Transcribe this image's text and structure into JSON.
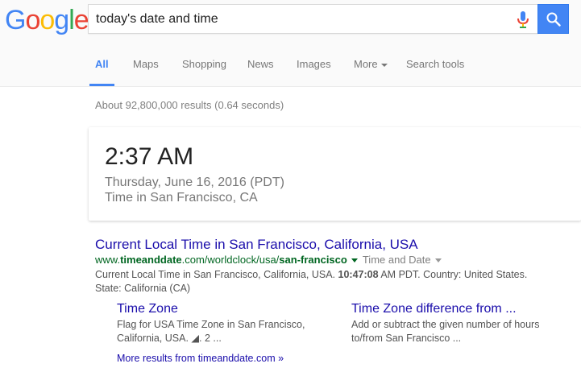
{
  "logo": {
    "letters": [
      "G",
      "o",
      "o",
      "g",
      "l",
      "e"
    ]
  },
  "search": {
    "query": "today's date and time"
  },
  "tabs": [
    {
      "label": "All"
    },
    {
      "label": "Maps"
    },
    {
      "label": "Shopping"
    },
    {
      "label": "News"
    },
    {
      "label": "Images"
    },
    {
      "label": "More"
    },
    {
      "label": "Search tools"
    }
  ],
  "stats": "About 92,800,000 results (0.64 seconds)",
  "time_card": {
    "time": "2:37 AM",
    "date": "Thursday, June 16, 2016 (PDT)",
    "location": "Time in San Francisco, CA"
  },
  "result": {
    "title": "Current Local Time in San Francisco, California, USA",
    "url_prefix": "www.",
    "url_domain": "timeanddate",
    "url_mid": ".com/worldclock/usa/",
    "url_path_bold": "san-francisco",
    "breadcrumb": "Time and Date",
    "snippet_start": "Current Local Time in San Francisco, California, USA. ",
    "snippet_bold": "10:47:08",
    "snippet_end": " AM PDT. Country: United States. State: California (CA)",
    "sitelinks": [
      {
        "title": "Time Zone",
        "desc": "Flag for USA Time Zone in San Francisco, California, USA. ◢. 2 ..."
      },
      {
        "title": "Time Zone difference from ...",
        "desc": "Add or subtract the given number of hours to/from San Francisco ..."
      }
    ],
    "more_results": "More results from timeanddate.com »"
  },
  "icons": {
    "mic": "mic-icon",
    "search": "search-icon"
  },
  "colors": {
    "link": "#1a0dab",
    "url": "#006621",
    "accent": "#4285f4"
  }
}
